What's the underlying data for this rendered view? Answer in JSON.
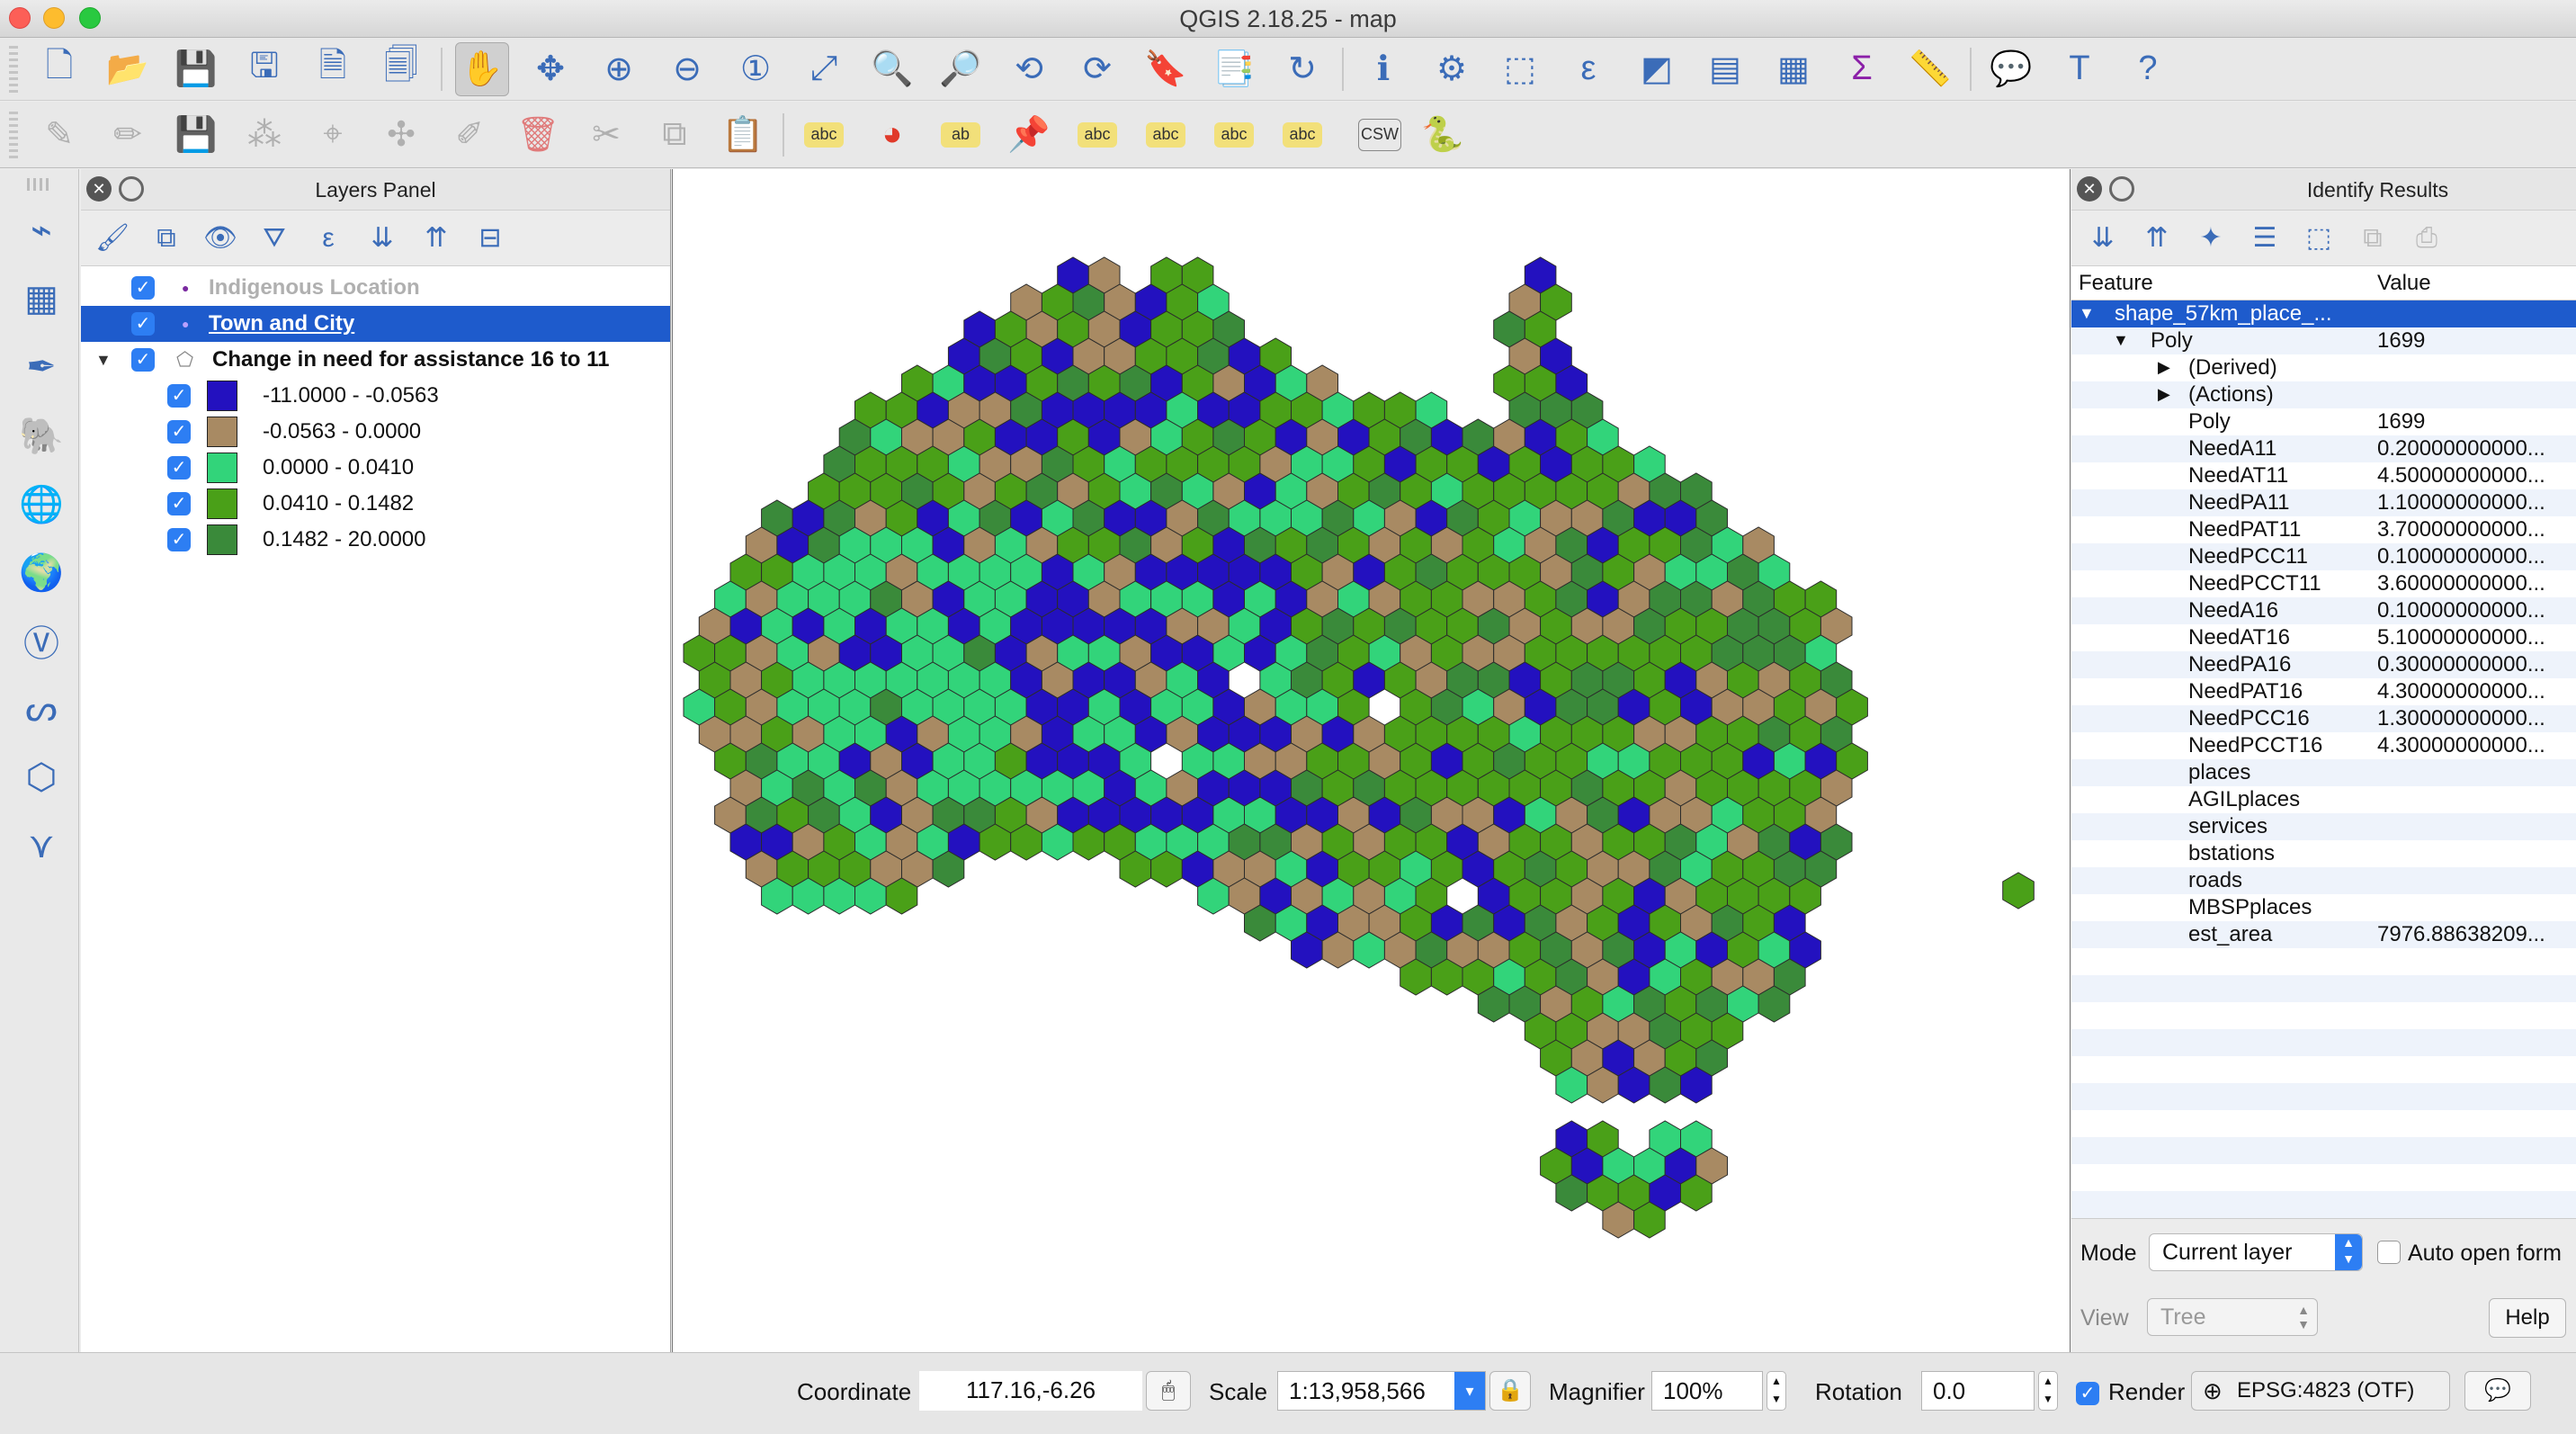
{
  "window": {
    "title": "QGIS 2.18.25 - map"
  },
  "toolbar_top": {
    "icons": [
      "new-project-icon",
      "open-project-icon",
      "save-project-icon",
      "save-as-icon",
      "new-print-composer-icon",
      "composer-manager-icon",
      "pan-icon",
      "pan-to-selection-icon",
      "zoom-in-icon",
      "zoom-out-icon",
      "zoom-native-icon",
      "zoom-full-icon",
      "zoom-to-selection-icon",
      "zoom-to-layer-icon",
      "zoom-last-icon",
      "zoom-next-icon",
      "new-bookmark-icon",
      "show-bookmarks-icon",
      "refresh-icon",
      "identify-icon",
      "run-action-icon",
      "select-features-icon",
      "select-by-expression-icon",
      "deselect-icon",
      "attribute-table-icon",
      "field-calculator-icon",
      "statistics-icon",
      "measure-icon",
      "map-tips-icon",
      "text-annotation-icon",
      "help-icon"
    ]
  },
  "toolbar_second": {
    "icons": [
      "toggle-editing-icon",
      "current-edits-icon",
      "save-edits-icon",
      "add-feature-icon",
      "node-tool-icon",
      "move-feature-icon",
      "modify-attributes-icon",
      "delete-selected-icon",
      "cut-features-icon",
      "copy-features-icon",
      "paste-features-icon",
      "label-tool-icon",
      "diagram-tool-icon",
      "highlight-pinned-labels-icon",
      "pin-labels-icon",
      "show-hide-labels-icon",
      "move-label-icon",
      "rotate-label-icon",
      "change-label-icon"
    ],
    "csw_label": "CSW"
  },
  "layers_panel": {
    "title": "Layers Panel",
    "layers": [
      {
        "name": "Indigenous Location",
        "checked": true,
        "state": "inactive"
      },
      {
        "name": "Town and City",
        "checked": true,
        "state": "selected"
      },
      {
        "name": "Change in need for assistance 16 to 11",
        "checked": true,
        "state": "expanded"
      }
    ],
    "legend": [
      {
        "label": "-11.0000 - -0.0563",
        "color": "#2311bf"
      },
      {
        "label": "-0.0563 - 0.0000",
        "color": "#a88a63"
      },
      {
        "label": "0.0000 - 0.0410",
        "color": "#32d47a"
      },
      {
        "label": "0.0410 - 0.1482",
        "color": "#4aa018"
      },
      {
        "label": "0.1482 - 20.0000",
        "color": "#3a8a3a"
      }
    ]
  },
  "identify_panel": {
    "title": "Identify Results",
    "columns": [
      "Feature",
      "Value"
    ],
    "rows": [
      {
        "key": "shape_57km_place_...",
        "value": "",
        "level": 0,
        "selected": true
      },
      {
        "key": "Poly",
        "value": "1699",
        "level": 1
      },
      {
        "key": "(Derived)",
        "value": "",
        "level": 2,
        "expandable": true
      },
      {
        "key": "(Actions)",
        "value": "",
        "level": 2,
        "expandable": true
      },
      {
        "key": "Poly",
        "value": "1699",
        "level": 2
      },
      {
        "key": "NeedA11",
        "value": "0.20000000000...",
        "level": 2
      },
      {
        "key": "NeedAT11",
        "value": "4.50000000000...",
        "level": 2
      },
      {
        "key": "NeedPA11",
        "value": "1.10000000000...",
        "level": 2
      },
      {
        "key": "NeedPAT11",
        "value": "3.70000000000...",
        "level": 2
      },
      {
        "key": "NeedPCC11",
        "value": "0.10000000000...",
        "level": 2
      },
      {
        "key": "NeedPCCT11",
        "value": "3.60000000000...",
        "level": 2
      },
      {
        "key": "NeedA16",
        "value": "0.10000000000...",
        "level": 2
      },
      {
        "key": "NeedAT16",
        "value": "5.10000000000...",
        "level": 2
      },
      {
        "key": "NeedPA16",
        "value": "0.30000000000...",
        "level": 2
      },
      {
        "key": "NeedPAT16",
        "value": "4.30000000000...",
        "level": 2
      },
      {
        "key": "NeedPCC16",
        "value": "1.30000000000...",
        "level": 2
      },
      {
        "key": "NeedPCCT16",
        "value": "4.30000000000...",
        "level": 2
      },
      {
        "key": "places",
        "value": "",
        "level": 2
      },
      {
        "key": "AGILplaces",
        "value": "",
        "level": 2
      },
      {
        "key": "services",
        "value": "",
        "level": 2
      },
      {
        "key": "bstations",
        "value": "",
        "level": 2
      },
      {
        "key": "roads",
        "value": "",
        "level": 2
      },
      {
        "key": "MBSPplaces",
        "value": "",
        "level": 2
      },
      {
        "key": "est_area",
        "value": "7976.88638209...",
        "level": 2
      }
    ],
    "mode_label": "Mode",
    "mode_value": "Current layer",
    "auto_open_label": "Auto open form",
    "view_label": "View",
    "view_value": "Tree",
    "help_label": "Help"
  },
  "statusbar": {
    "coordinate_label": "Coordinate",
    "coordinate_value": "117.16,-6.26",
    "scale_label": "Scale",
    "scale_value": "1:13,958,566",
    "magnifier_label": "Magnifier",
    "magnifier_value": "100%",
    "rotation_label": "Rotation",
    "rotation_value": "0.0",
    "render_label": "Render",
    "crs_label": "EPSG:4823 (OTF)"
  }
}
